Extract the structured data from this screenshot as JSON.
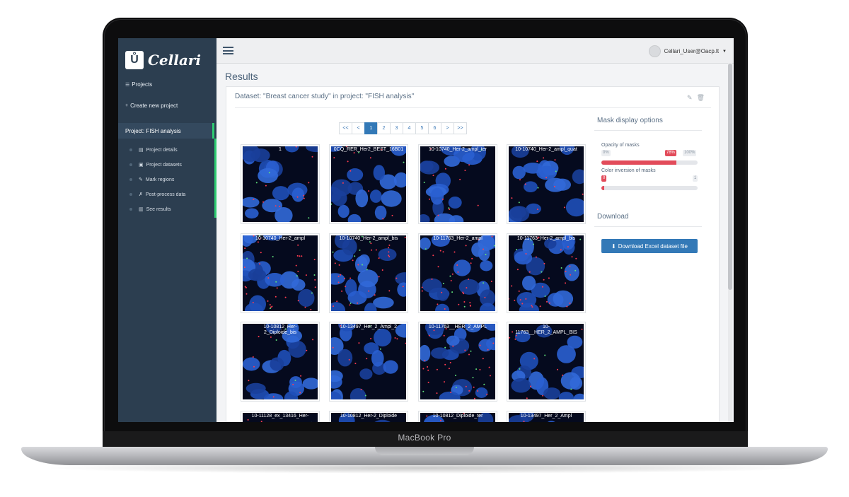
{
  "device": {
    "label": "MacBook Pro"
  },
  "sidebar": {
    "logo_text": "Cellari",
    "projects_label": "Projects",
    "create_label": "Create new project",
    "project_header": "Project: FISH analysis",
    "items": [
      {
        "label": "Project details",
        "icon": "file-icon"
      },
      {
        "label": "Project datasets",
        "icon": "images-icon"
      },
      {
        "label": "Mark regions",
        "icon": "edit-icon"
      },
      {
        "label": "Post-process data",
        "icon": "wrench-icon"
      },
      {
        "label": "See results",
        "icon": "chart-icon"
      }
    ]
  },
  "topbar": {
    "user_label": "Cellari_User@Oacp.lt"
  },
  "main": {
    "title": "Results",
    "dataset_heading": "Dataset: \"Breast cancer study\" in project: \"FISH analysis\"",
    "pagination": [
      "<<",
      "<",
      "1",
      "2",
      "3",
      "4",
      "5",
      "6",
      ">",
      ">>"
    ],
    "active_page": "1",
    "thumbnails": [
      {
        "label": "1"
      },
      {
        "label": "0CQ_RER_Her2_BEST_16B01"
      },
      {
        "label": "10-10740_Her-2_ampl_ter"
      },
      {
        "label": "10-10740_Her-2_ampl_quat"
      },
      {
        "label": "10-10740_Her-2_ampl"
      },
      {
        "label": "10-10740_Her-2_ampl_bis"
      },
      {
        "label": "10-11763_Her-2_ampl"
      },
      {
        "label": "10-11763_Her-2_ampl_bis"
      },
      {
        "label": "10-10812_Her-\n2_Diploide_bis"
      },
      {
        "label": "10-13497_Her_2_Ampl_2"
      },
      {
        "label": "10-11763__HER_2_AMPL"
      },
      {
        "label": "10-\n11763__HER_2_AMPL_BIS"
      },
      {
        "label": "10-11128_ex_13416_Her-"
      },
      {
        "label": "10-10812_Her-2_Diploide"
      },
      {
        "label": "10-10812_Diploide_ter"
      },
      {
        "label": "10-13497_Her_2_Ampl"
      }
    ]
  },
  "mask_options": {
    "title": "Mask display options",
    "opacity_label": "Opacity of masks",
    "opacity_value": "78%",
    "opacity_min": "0%",
    "opacity_max": "100%",
    "inversion_label": "Color inversion of masks",
    "inversion_value": "0",
    "inversion_max": "1"
  },
  "download": {
    "title": "Download",
    "button_label": "Download Excel dataset file"
  },
  "colors": {
    "sidebar": "#2c3e50",
    "accent_green": "#2ecc71",
    "primary_blue": "#3379b7",
    "slider_red": "#e24b5a"
  }
}
